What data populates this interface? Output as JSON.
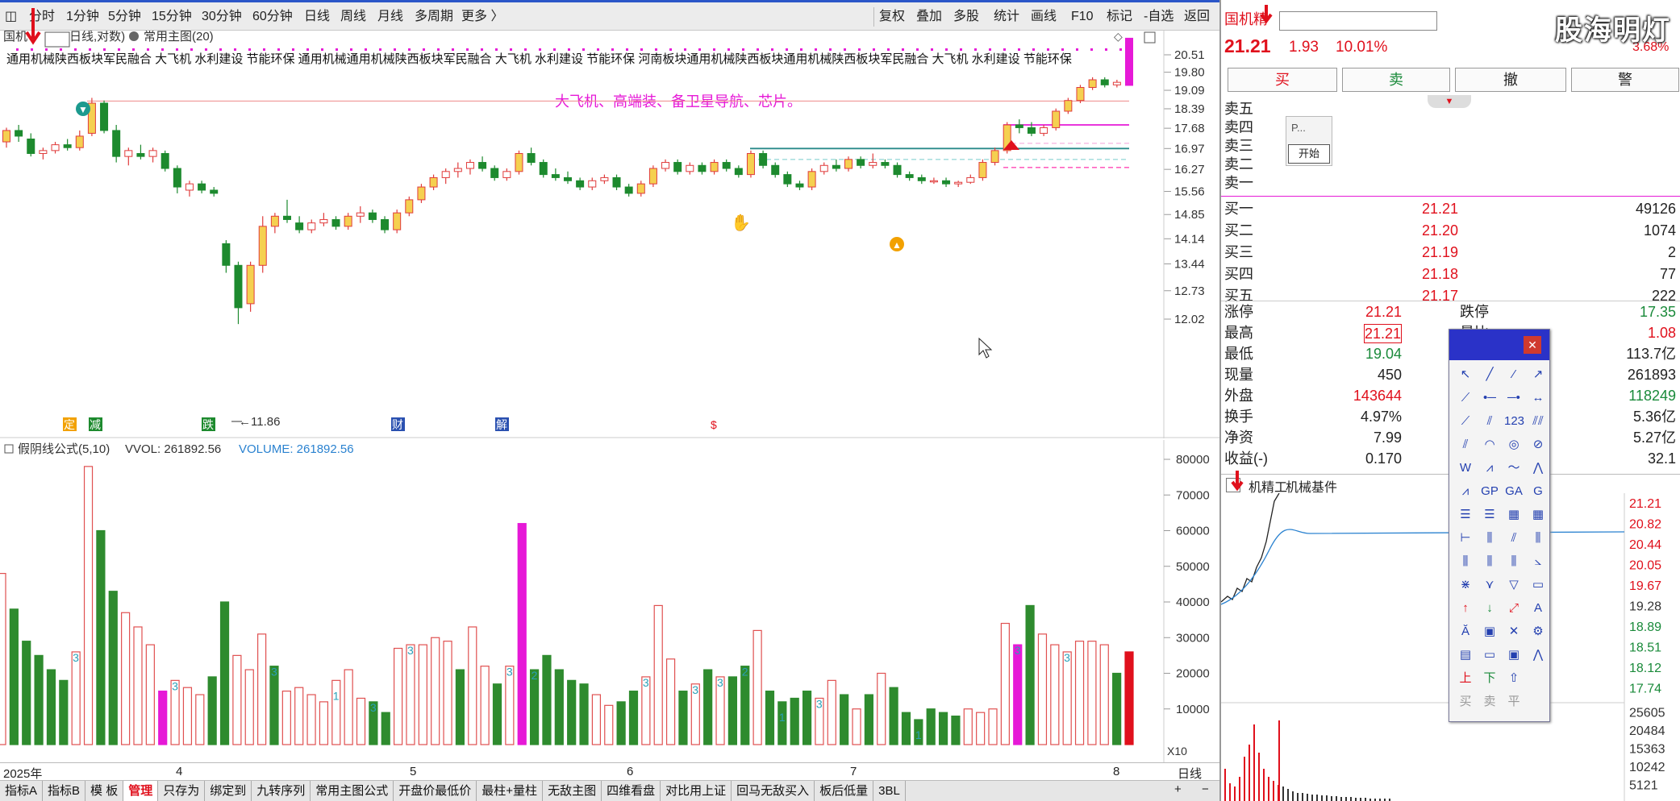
{
  "toolbar": {
    "periods": [
      "分时",
      "1分钟",
      "5分钟",
      "15分钟",
      "30分钟",
      "60分钟",
      "日线",
      "周线",
      "月线",
      "多周期",
      "更多 〉"
    ],
    "right": [
      "复权",
      "叠加",
      "多股",
      "统计",
      "画线",
      "F10",
      "标记",
      "-自选",
      "返回"
    ]
  },
  "main": {
    "stock_label": "国机",
    "mode_label": "日线,对数)",
    "indicator_label": "常用主图(20)",
    "concepts": "通用机械陕西板块军民融合 大飞机 水利建设 节能环保 通用机械通用机械陕西板块军民融合 大飞机 水利建设 节能环保 河南板块通用机械陕西板块通用机械陕西板块军民融合 大飞机 水利建设 节能环保",
    "annotation": "大飞机、高端装、备卫星导航、芯片。",
    "low_label": "←11.86",
    "events": [
      "定",
      "减",
      "跌",
      "财",
      "解",
      "$"
    ]
  },
  "chart_data": {
    "type": "candlestick",
    "price_axis_ticks": [
      "20.51",
      "19.80",
      "19.09",
      "18.39",
      "17.68",
      "16.97",
      "16.27",
      "15.56",
      "14.85",
      "14.14",
      "13.44",
      "12.73",
      "12.02"
    ],
    "low_marker": 11.86,
    "candles": [
      [
        17.2,
        17.7,
        17.0,
        17.6
      ],
      [
        17.6,
        17.8,
        17.2,
        17.4
      ],
      [
        17.3,
        17.5,
        16.7,
        16.8
      ],
      [
        16.8,
        17.0,
        16.6,
        16.9
      ],
      [
        16.9,
        17.2,
        16.8,
        17.1
      ],
      [
        17.1,
        17.3,
        16.9,
        17.0
      ],
      [
        17.0,
        17.6,
        16.9,
        17.4
      ],
      [
        17.5,
        18.8,
        17.4,
        18.6
      ],
      [
        18.6,
        18.7,
        17.5,
        17.6
      ],
      [
        17.6,
        17.8,
        16.5,
        16.7
      ],
      [
        16.7,
        17.0,
        16.4,
        16.9
      ],
      [
        16.8,
        17.1,
        16.6,
        16.7
      ],
      [
        16.7,
        17.0,
        16.5,
        16.9
      ],
      [
        16.8,
        16.9,
        16.2,
        16.3
      ],
      [
        16.3,
        16.4,
        15.5,
        15.7
      ],
      [
        15.6,
        15.9,
        15.4,
        15.8
      ],
      [
        15.8,
        15.9,
        15.5,
        15.6
      ],
      [
        15.6,
        15.7,
        15.4,
        15.5
      ],
      [
        14.0,
        14.1,
        13.2,
        13.4
      ],
      [
        13.4,
        13.5,
        11.9,
        12.3
      ],
      [
        12.4,
        13.5,
        12.2,
        13.4
      ],
      [
        13.4,
        14.8,
        13.2,
        14.5
      ],
      [
        14.5,
        14.9,
        14.3,
        14.8
      ],
      [
        14.8,
        15.3,
        14.6,
        14.7
      ],
      [
        14.6,
        14.8,
        14.3,
        14.4
      ],
      [
        14.4,
        14.7,
        14.3,
        14.6
      ],
      [
        14.6,
        14.9,
        14.5,
        14.7
      ],
      [
        14.7,
        14.8,
        14.4,
        14.5
      ],
      [
        14.5,
        14.9,
        14.4,
        14.8
      ],
      [
        14.8,
        15.1,
        14.6,
        14.9
      ],
      [
        14.9,
        15.0,
        14.6,
        14.7
      ],
      [
        14.7,
        14.8,
        14.3,
        14.4
      ],
      [
        14.4,
        15.0,
        14.3,
        14.9
      ],
      [
        14.9,
        15.4,
        14.8,
        15.3
      ],
      [
        15.3,
        15.8,
        15.2,
        15.7
      ],
      [
        15.7,
        16.1,
        15.6,
        16.0
      ],
      [
        16.0,
        16.3,
        15.8,
        16.2
      ],
      [
        16.2,
        16.5,
        16.0,
        16.3
      ],
      [
        16.3,
        16.6,
        16.1,
        16.5
      ],
      [
        16.5,
        16.7,
        16.2,
        16.3
      ],
      [
        16.3,
        16.4,
        15.9,
        16.0
      ],
      [
        16.0,
        16.3,
        15.9,
        16.2
      ],
      [
        16.2,
        16.9,
        16.1,
        16.8
      ],
      [
        16.8,
        17.0,
        16.4,
        16.5
      ],
      [
        16.5,
        16.6,
        16.0,
        16.1
      ],
      [
        16.1,
        16.3,
        15.9,
        16.0
      ],
      [
        16.0,
        16.2,
        15.8,
        15.9
      ],
      [
        15.9,
        16.0,
        15.6,
        15.7
      ],
      [
        15.7,
        16.0,
        15.6,
        15.9
      ],
      [
        15.9,
        16.1,
        15.8,
        16.0
      ],
      [
        16.0,
        16.1,
        15.6,
        15.7
      ],
      [
        15.7,
        15.8,
        15.4,
        15.5
      ],
      [
        15.5,
        15.9,
        15.4,
        15.8
      ],
      [
        15.8,
        16.4,
        15.7,
        16.3
      ],
      [
        16.3,
        16.6,
        16.2,
        16.5
      ],
      [
        16.5,
        16.6,
        16.1,
        16.2
      ],
      [
        16.2,
        16.5,
        16.1,
        16.4
      ],
      [
        16.4,
        16.5,
        16.1,
        16.2
      ],
      [
        16.2,
        16.6,
        16.1,
        16.5
      ],
      [
        16.5,
        16.6,
        16.2,
        16.3
      ],
      [
        16.3,
        16.4,
        16.0,
        16.1
      ],
      [
        16.1,
        16.9,
        16.0,
        16.8
      ],
      [
        16.8,
        16.9,
        16.3,
        16.4
      ],
      [
        16.4,
        16.5,
        16.0,
        16.1
      ],
      [
        16.1,
        16.2,
        15.7,
        15.8
      ],
      [
        15.8,
        15.9,
        15.6,
        15.7
      ],
      [
        15.7,
        16.3,
        15.6,
        16.2
      ],
      [
        16.2,
        16.5,
        16.1,
        16.4
      ],
      [
        16.4,
        16.6,
        16.2,
        16.3
      ],
      [
        16.3,
        16.7,
        16.2,
        16.6
      ],
      [
        16.6,
        16.7,
        16.3,
        16.4
      ],
      [
        16.4,
        16.8,
        16.3,
        16.5
      ],
      [
        16.5,
        16.6,
        16.3,
        16.4
      ],
      [
        16.4,
        16.5,
        16.0,
        16.1
      ],
      [
        16.1,
        16.2,
        15.9,
        16.0
      ],
      [
        16.0,
        16.1,
        15.8,
        15.9
      ],
      [
        15.9,
        16.0,
        15.8,
        15.9
      ],
      [
        15.9,
        16.0,
        15.7,
        15.8
      ],
      [
        15.8,
        15.9,
        15.7,
        15.85
      ],
      [
        15.85,
        16.1,
        15.8,
        16.0
      ],
      [
        16.0,
        16.6,
        15.9,
        16.5
      ],
      [
        16.5,
        17.0,
        16.4,
        16.9
      ],
      [
        16.9,
        17.9,
        16.8,
        17.8
      ],
      [
        17.8,
        18.0,
        17.5,
        17.7
      ],
      [
        17.7,
        17.9,
        17.4,
        17.5
      ],
      [
        17.5,
        17.8,
        17.4,
        17.7
      ],
      [
        17.7,
        18.4,
        17.6,
        18.3
      ],
      [
        18.3,
        18.8,
        18.2,
        18.7
      ],
      [
        18.7,
        19.3,
        18.6,
        19.2
      ],
      [
        19.2,
        19.6,
        19.1,
        19.5
      ],
      [
        19.5,
        19.6,
        19.2,
        19.3
      ],
      [
        19.3,
        19.5,
        19.2,
        19.4
      ],
      [
        19.28,
        21.21,
        19.28,
        21.21
      ]
    ],
    "resistance_lines": [
      18.68,
      17.8,
      17.15,
      16.97,
      16.6,
      16.33
    ]
  },
  "volume": {
    "name": "假阴线公式(5,10)",
    "vvol": "VVOL: 261892.56",
    "volume": "VOLUME: 261892.56",
    "scale": "X10",
    "ticks": [
      "80000",
      "70000",
      "60000",
      "50000",
      "40000",
      "30000",
      "20000",
      "10000"
    ],
    "bars": [
      48000,
      38000,
      29000,
      25000,
      21000,
      18000,
      26000,
      78000,
      60000,
      43000,
      37000,
      33000,
      28000,
      15000,
      18000,
      16000,
      14000,
      19000,
      40000,
      25000,
      21000,
      31000,
      22000,
      15000,
      16000,
      14000,
      12000,
      18000,
      21000,
      13000,
      12000,
      9000,
      27000,
      28000,
      28000,
      30000,
      29000,
      21000,
      33000,
      22000,
      17000,
      22000,
      62000,
      21000,
      25000,
      21000,
      18000,
      17000,
      14000,
      11000,
      12000,
      15000,
      19000,
      39000,
      24000,
      15000,
      17000,
      21000,
      19000,
      19000,
      22000,
      32000,
      15000,
      12000,
      13000,
      15000,
      13000,
      18000,
      14000,
      10000,
      14000,
      20000,
      16000,
      9000,
      7000,
      10000,
      9000,
      8000,
      10000,
      9000,
      10000,
      34000,
      28000,
      39000,
      31000,
      28000,
      26000,
      29000,
      29000,
      28000,
      20000,
      26000
    ],
    "rising": [
      1,
      0,
      0,
      0,
      0,
      0,
      1,
      1,
      0,
      0,
      1,
      1,
      1,
      0,
      1,
      1,
      1,
      0,
      0,
      1,
      1,
      1,
      0,
      1,
      1,
      1,
      1,
      1,
      1,
      1,
      0,
      0,
      1,
      1,
      1,
      1,
      1,
      0,
      1,
      1,
      0,
      1,
      1,
      0,
      0,
      0,
      0,
      0,
      1,
      1,
      0,
      0,
      1,
      1,
      1,
      0,
      1,
      0,
      1,
      0,
      0,
      1,
      0,
      0,
      0,
      0,
      1,
      1,
      0,
      1,
      0,
      1,
      0,
      0,
      0,
      0,
      0,
      0,
      1,
      1,
      1,
      1,
      1,
      0,
      1,
      1,
      1,
      1,
      1,
      1,
      0,
      1
    ],
    "marks": [
      {
        "i": 6,
        "t": "3"
      },
      {
        "i": 14,
        "t": "3"
      },
      {
        "i": 22,
        "t": "3"
      },
      {
        "i": 27,
        "t": "1"
      },
      {
        "i": 30,
        "t": "3"
      },
      {
        "i": 33,
        "t": "3"
      },
      {
        "i": 41,
        "t": "3"
      },
      {
        "i": 43,
        "t": "2"
      },
      {
        "i": 52,
        "t": "3"
      },
      {
        "i": 56,
        "t": "3"
      },
      {
        "i": 58,
        "t": "3"
      },
      {
        "i": 60,
        "t": "2"
      },
      {
        "i": 63,
        "t": "1"
      },
      {
        "i": 66,
        "t": "3"
      },
      {
        "i": 74,
        "t": "1"
      },
      {
        "i": 82,
        "t": "3"
      },
      {
        "i": 86,
        "t": "3"
      }
    ],
    "magenta_bars": [
      13,
      42,
      82
    ]
  },
  "dates": {
    "year": "2025年",
    "m4": "4",
    "m5": "5",
    "m6": "6",
    "m7": "7",
    "m8": "8",
    "period": "日线"
  },
  "tabs": [
    "指标A",
    "指标B",
    "模 板",
    "管理",
    "只存为",
    "绑定到",
    "九转序列",
    "常用主图公式",
    "开盘价最低价",
    "最柱+量柱",
    "无敌主图",
    "四维看盘",
    "对比用上证",
    "回马无敌买入",
    "板后低量",
    "3BL"
  ],
  "quote": {
    "name": "国机精",
    "price": "21.21",
    "change": "1.93",
    "change_pct": "10.01%",
    "amp": "3.68%",
    "buttons": [
      "买",
      "卖",
      "撤",
      "警"
    ],
    "book": [
      {
        "label": "卖五",
        "price": "",
        "vol": ""
      },
      {
        "label": "卖四",
        "price": "",
        "vol": ""
      },
      {
        "label": "卖三",
        "price": "",
        "vol": ""
      },
      {
        "label": "卖二",
        "price": "",
        "vol": ""
      },
      {
        "label": "卖一",
        "price": "",
        "vol": ""
      },
      {
        "label": "买一",
        "price": "21.21",
        "vol": "49126"
      },
      {
        "label": "买二",
        "price": "21.20",
        "vol": "1074"
      },
      {
        "label": "买三",
        "price": "21.19",
        "vol": "2"
      },
      {
        "label": "买四",
        "price": "21.18",
        "vol": "77"
      },
      {
        "label": "买五",
        "price": "21.17",
        "vol": "222"
      }
    ],
    "stats": [
      {
        "l": "涨停",
        "v": "21.21",
        "l2": "跌停",
        "v2": "17.35",
        "c": "#e0101c",
        "c2": "#1a8a3a"
      },
      {
        "l": "最高",
        "v": "21.21",
        "l2": "量比",
        "v2": "1.08",
        "c": "#e0101c",
        "c2": "#e0101c"
      },
      {
        "l": "最低",
        "v": "19.04",
        "l2": "",
        "v2": "113.7亿",
        "c": "#1a8a3a",
        "c2": "#222"
      },
      {
        "l": "现量",
        "v": "450",
        "l2": "",
        "v2": "261893",
        "c": "#222",
        "c2": "#222"
      },
      {
        "l": "外盘",
        "v": "143644",
        "l2": "",
        "v2": "118249",
        "c": "#e0101c",
        "c2": "#1a8a3a"
      },
      {
        "l": "换手",
        "v": "4.97%",
        "l2": "",
        "v2": "5.36亿",
        "c": "#222",
        "c2": "#222"
      },
      {
        "l": "净资",
        "v": "7.99",
        "l2": "",
        "v2": "5.27亿",
        "c": "#222",
        "c2": "#222"
      },
      {
        "l": "收益(-)",
        "v": "0.170",
        "l2": "",
        "v2": "32.1",
        "c": "#222",
        "c2": "#222"
      }
    ]
  },
  "sector": {
    "tabs": [
      "机精工",
      "机械基件"
    ],
    "ticks": [
      "21.21",
      "20.82",
      "20.44",
      "20.05",
      "19.67",
      "19.28",
      "18.89",
      "18.51",
      "18.12",
      "17.74",
      "25605",
      "20484",
      "15363",
      "10242",
      "5121"
    ]
  },
  "popup": {
    "title": "P...",
    "button": "开始"
  },
  "tools": [
    "↖",
    "╱",
    "⁄",
    "↗",
    "⟋",
    "•─",
    "─•",
    "↔",
    "⟋",
    "⫽",
    "123",
    "⫽⫽",
    "⫽",
    "◠",
    "◎",
    "⊘",
    "W",
    "⩘",
    "〜",
    "⋀",
    "⩘",
    "GP",
    "GA",
    "G",
    "☰",
    "☰",
    "▦",
    "▦",
    "⊢",
    "⫼",
    "⫽",
    "⫼",
    "⫼",
    "⫼",
    "⫼",
    "⦣",
    "⋇",
    "⋎",
    "▽",
    "▭",
    "↑",
    "↓",
    "⤢",
    "A",
    "Ă",
    "▣",
    "✕",
    "⚙",
    "▤",
    "▭",
    "▣",
    "⋀",
    "上",
    "下",
    "⇧",
    "",
    "买",
    "卖",
    "平",
    ""
  ],
  "logo": "股海明灯"
}
